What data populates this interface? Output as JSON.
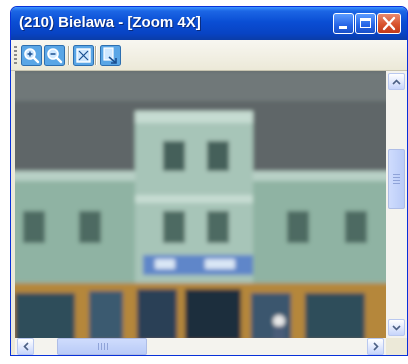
{
  "window": {
    "title": "(210) Bielawa - [Zoom 4X]"
  },
  "title_buttons": {
    "minimize_icon": "minimize-icon",
    "maximize_icon": "maximize-icon",
    "close_icon": "close-icon"
  },
  "toolbar": {
    "tools": [
      {
        "name": "zoom-in",
        "icon": "magnifier-plus-icon"
      },
      {
        "name": "zoom-out",
        "icon": "magnifier-minus-icon"
      },
      {
        "name": "fit-to-window",
        "icon": "fit-window-icon"
      },
      {
        "name": "export",
        "icon": "export-icon"
      }
    ]
  },
  "colors": {
    "titlebar": "#0a4ed4",
    "close_button": "#d8532d",
    "window_face": "#ece9d8"
  },
  "scrollbars": {
    "vertical_position": 0.35,
    "horizontal_position": 0.15
  }
}
